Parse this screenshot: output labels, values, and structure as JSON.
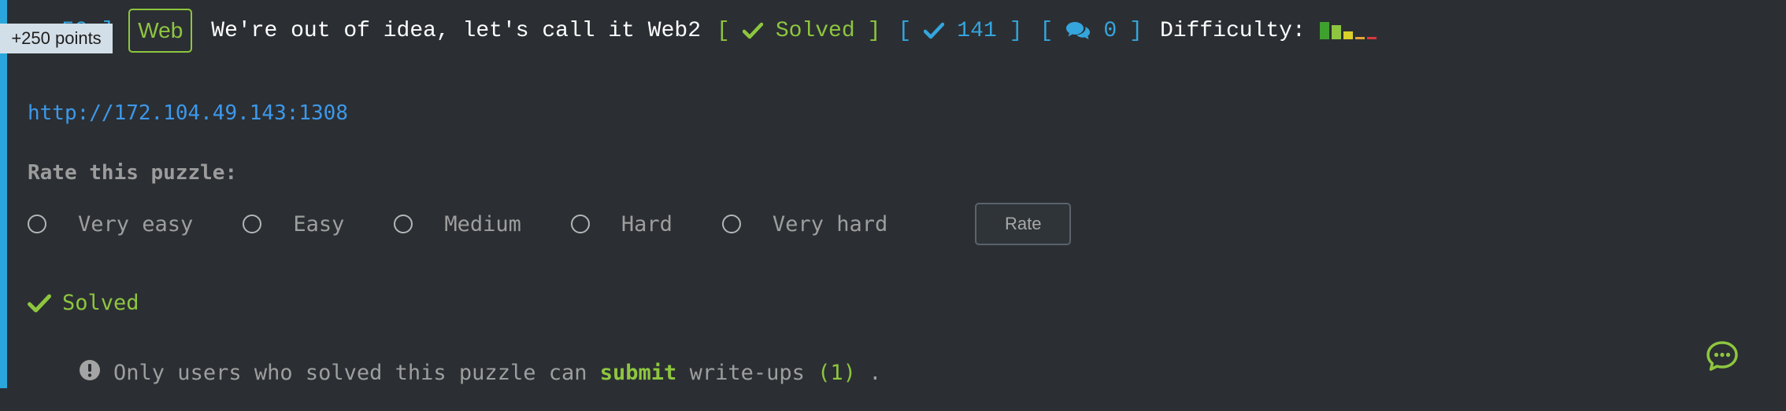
{
  "tooltip": {
    "text": "+250 points"
  },
  "header": {
    "points_fragment": "50 ]",
    "category_tag": "Web",
    "title": "We're out of idea, let's call it Web2",
    "solved_open": "[",
    "solved_label": "Solved",
    "solved_close": "]",
    "solves_open": "[",
    "solves_count": "141",
    "solves_close": "]",
    "comments_open": "[",
    "comments_count": "0",
    "comments_close": "]",
    "difficulty_label": "Difficulty:",
    "difficulty_bars": [
      {
        "color": "#3fa12d",
        "level": 1.0
      },
      {
        "color": "#8ec63f",
        "level": 0.8
      },
      {
        "color": "#d9d12a",
        "level": 0.45
      },
      {
        "color": "#e3a33a",
        "level": 0.15
      },
      {
        "color": "#d9363e",
        "level": 0.15
      }
    ]
  },
  "url": "http://172.104.49.143:1308",
  "rating": {
    "heading": "Rate this puzzle:",
    "options": [
      "Very easy",
      "Easy",
      "Medium",
      "Hard",
      "Very hard"
    ],
    "button_label": "Rate"
  },
  "status": {
    "solved_label": "Solved"
  },
  "writeup": {
    "prefix": "Only users who solved this puzzle can",
    "link_label": "submit",
    "suffix": "write-ups",
    "count": "(1)",
    "end": "."
  },
  "icons": {
    "check": "check-icon",
    "comment": "comments-icon",
    "info": "exclamation-circle-icon",
    "chat": "chat-bubble-icon"
  },
  "colors": {
    "background": "#2b2f33",
    "accent_blue": "#35a5dd",
    "accent_green": "#8ec63f",
    "link_blue": "#3d98ea"
  }
}
